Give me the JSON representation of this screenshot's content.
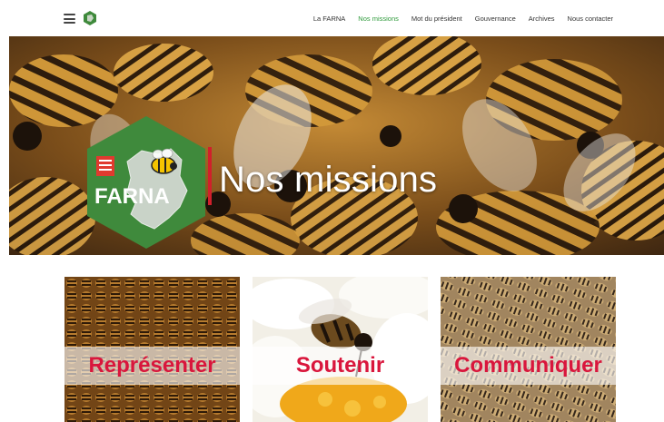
{
  "nav": {
    "items": [
      {
        "label": "La FARNA",
        "active": false
      },
      {
        "label": "Nos missions",
        "active": true
      },
      {
        "label": "Mot du président",
        "active": false
      },
      {
        "label": "Gouvernance",
        "active": false
      },
      {
        "label": "Archives",
        "active": false
      },
      {
        "label": "Nous contacter",
        "active": false
      }
    ]
  },
  "hero": {
    "title": "Nos missions",
    "logo_text": "FARNA"
  },
  "cards": [
    {
      "label": "Représenter"
    },
    {
      "label": "Soutenir"
    },
    {
      "label": "Communiquer"
    }
  ],
  "colors": {
    "accent_green": "#2e9a3a",
    "brand_red": "#d9163c",
    "logo_green": "#3f8a3c"
  },
  "icons": [
    "menu-icon",
    "farna-logo-icon",
    "bee-icon"
  ]
}
